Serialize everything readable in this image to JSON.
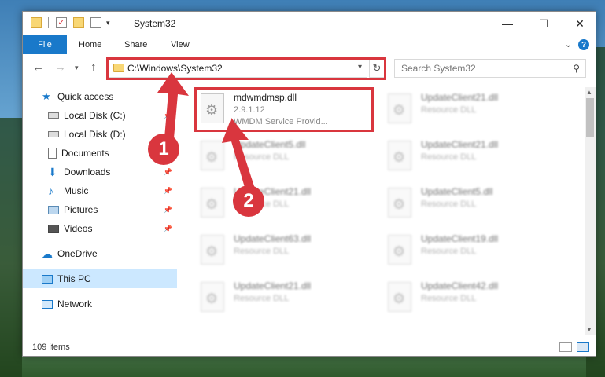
{
  "window": {
    "title": "System32",
    "controls": {
      "minimize": "—",
      "maximize": "☐",
      "close": "✕"
    }
  },
  "ribbon": {
    "tabs": [
      "File",
      "Home",
      "Share",
      "View"
    ],
    "help": "?"
  },
  "address_bar": {
    "path": "C:\\Windows\\System32",
    "search_placeholder": "Search System32"
  },
  "sidebar": {
    "items": [
      {
        "label": "Quick access",
        "icon": "star-icon"
      },
      {
        "label": "Local Disk (C:)",
        "icon": "drive-icon",
        "pinned": true
      },
      {
        "label": "Local Disk (D:)",
        "icon": "drive-icon"
      },
      {
        "label": "Documents",
        "icon": "documents-icon",
        "pinned": true
      },
      {
        "label": "Downloads",
        "icon": "download-icon",
        "pinned": true
      },
      {
        "label": "Music",
        "icon": "music-icon",
        "pinned": true
      },
      {
        "label": "Pictures",
        "icon": "pictures-icon",
        "pinned": true
      },
      {
        "label": "Videos",
        "icon": "videos-icon",
        "pinned": true
      },
      {
        "label": "OneDrive",
        "icon": "cloud-icon"
      },
      {
        "label": "This PC",
        "icon": "computer-icon",
        "selected": true
      },
      {
        "label": "Network",
        "icon": "network-icon"
      }
    ]
  },
  "files": [
    {
      "name": "mdwmdmsp.dll",
      "line2": "2.9.1.12",
      "line3": "WMDM Service Provid..."
    },
    {
      "name": "UpdateClient21.dll",
      "line2": "Resource DLL"
    },
    {
      "name": "UpdateClient5.dll",
      "line2": "Resource DLL"
    },
    {
      "name": "UpdateClient21.dll",
      "line2": "Resource DLL"
    },
    {
      "name": "UpdateClient21.dll",
      "line2": "Resource DLL"
    },
    {
      "name": "UpdateClient5.dll",
      "line2": "Resource DLL"
    },
    {
      "name": "UpdateClient63.dll",
      "line2": "Resource DLL"
    },
    {
      "name": "UpdateClient19.dll",
      "line2": "Resource DLL"
    },
    {
      "name": "UpdateClient21.dll",
      "line2": "Resource DLL"
    },
    {
      "name": "UpdateClient42.dll",
      "line2": "Resource DLL"
    }
  ],
  "status_bar": {
    "item_count": "109 items"
  },
  "annotations": {
    "step1": "1",
    "step2": "2"
  },
  "colors": {
    "accent": "#1979ca",
    "highlight_red": "#d9363e",
    "selected_bg": "#cce8ff"
  }
}
